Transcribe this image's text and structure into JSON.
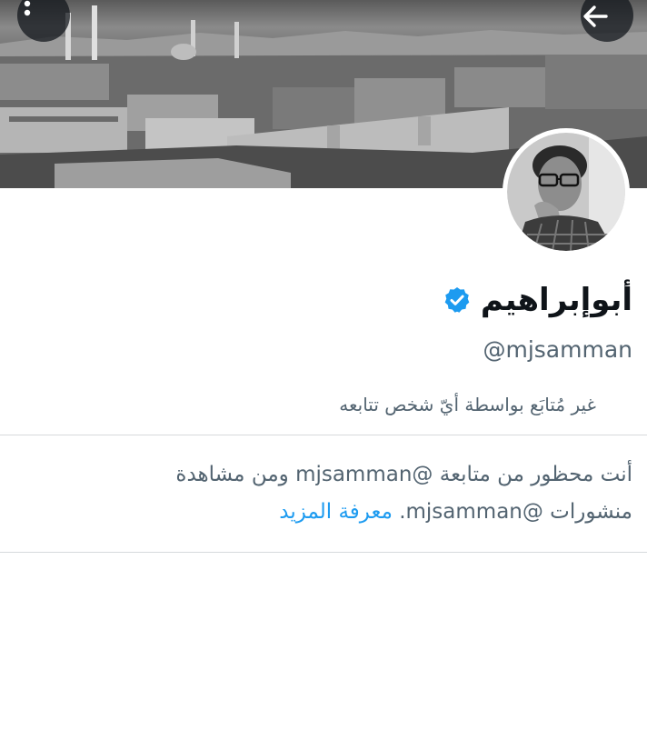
{
  "profile": {
    "display_name": "أبوإبراهيم",
    "handle": "@mjsamman",
    "verified": true,
    "follow_note": "غير مُتابَع بواسطة أيّ شخص تتابعه"
  },
  "blocked_notice": {
    "text": "أنت محظور من متابعة @mjsamman ومن مشاهدة منشورات @mjsamman.",
    "learn_more": "معرفة المزيد"
  },
  "icons": {
    "more": "more-vertical-icon",
    "back": "arrow-left-icon",
    "verified": "verified-badge-icon"
  },
  "colors": {
    "accent": "#1d9bf0",
    "secondary_text": "#536471",
    "divider": "#d6d9dc"
  }
}
